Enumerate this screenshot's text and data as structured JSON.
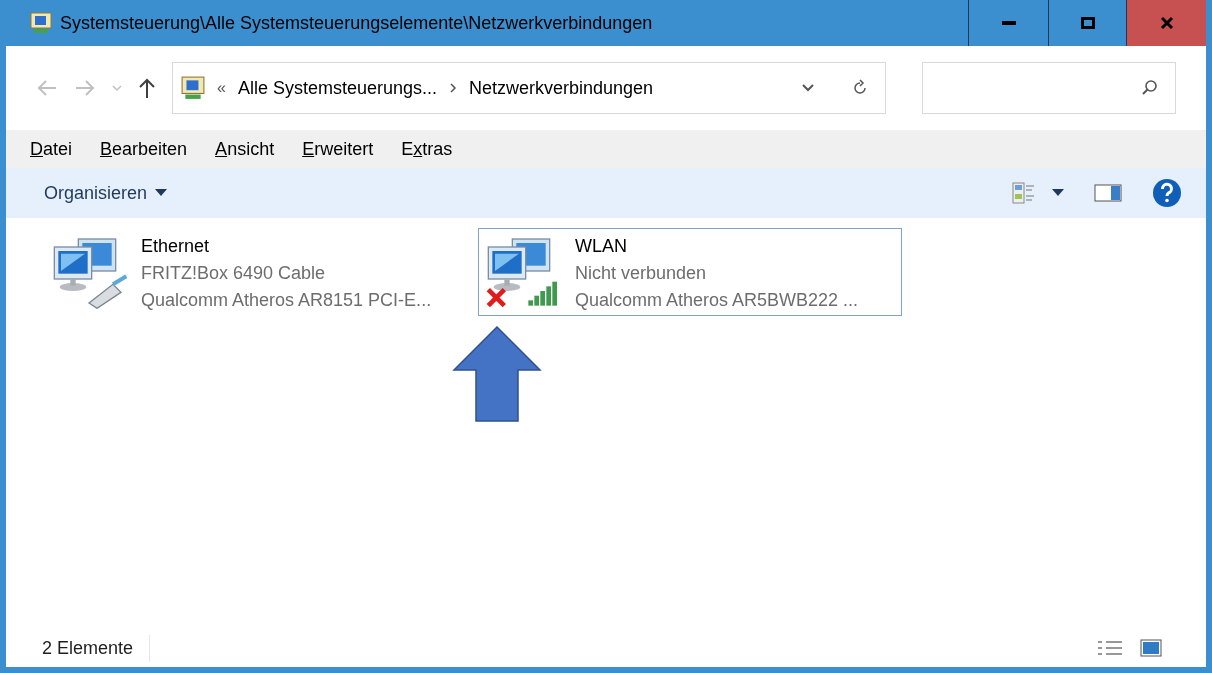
{
  "window": {
    "title": "Systemsteuerung\\Alle Systemsteuerungselemente\\Netzwerkverbindungen"
  },
  "address_bar": {
    "overflow": "«",
    "segments": [
      "Alle Systemsteuerungs...",
      "Netzwerkverbindungen"
    ]
  },
  "menu": [
    {
      "accel": "D",
      "after": "atei"
    },
    {
      "accel": "B",
      "after": "earbeiten"
    },
    {
      "accel": "A",
      "after": "nsicht"
    },
    {
      "accel": "E",
      "after": "rweitert"
    },
    {
      "before": "E",
      "accel": "x",
      "after": "tras"
    }
  ],
  "command_bar": {
    "organize": "Organisieren"
  },
  "connections": [
    {
      "kind": "ethernet",
      "name": "Ethernet",
      "status": "FRITZ!Box 6490 Cable",
      "device": "Qualcomm Atheros AR8151 PCI-E...",
      "selected": false,
      "disconnected": false
    },
    {
      "kind": "wifi",
      "name": "WLAN",
      "status": "Nicht verbunden",
      "device": "Qualcomm Atheros AR5BWB222 ...",
      "selected": true,
      "disconnected": true
    }
  ],
  "status_bar": {
    "count": "2 Elemente"
  }
}
